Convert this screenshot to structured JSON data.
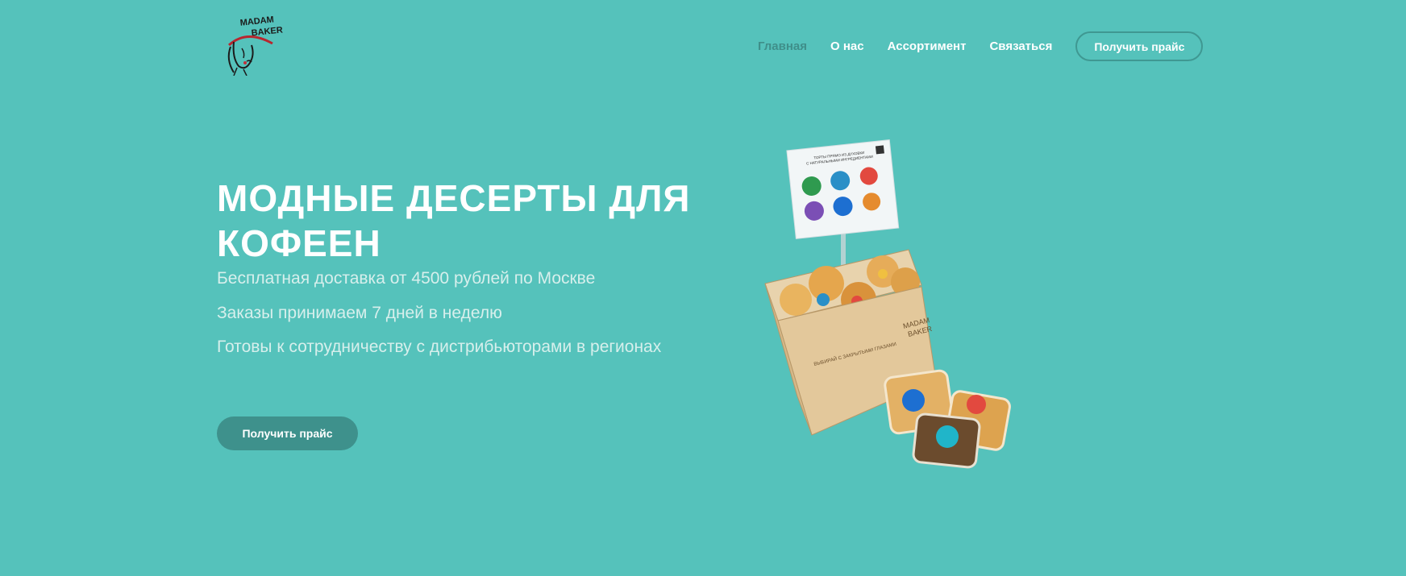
{
  "header": {
    "logo_text": [
      "MADAM",
      "BAKER"
    ],
    "nav": [
      {
        "label": "Главная",
        "active": true
      },
      {
        "label": "О нас",
        "active": false
      },
      {
        "label": "Ассортимент",
        "active": false
      },
      {
        "label": "Связаться",
        "active": false
      }
    ],
    "cta_label": "Получить прайс"
  },
  "hero": {
    "title": "МОДНЫЕ ДЕСЕРТЫ ДЛЯ КОФЕЕН",
    "lines": [
      "Бесплатная доставка от 4500 рублей по Москве",
      "Заказы принимаем 7 дней в неделю",
      "Готовы к сотрудничеству с дистрибьюторами в регионах"
    ],
    "cta_label": "Получить прайс"
  },
  "product_image": {
    "sign_lines": [
      "ТОРТЫ ПРЯМО ИЗ ДУХОВКИ",
      "С НАТУРАЛЬНЫМИ ИНГРЕДИЕНТАМИ"
    ],
    "box_text": "ВЫБИРАЙ С ЗАКРЫТЫМИ ГЛАЗАМИ",
    "box_brand": [
      "MADAM",
      "BAKER"
    ]
  },
  "colors": {
    "background": "#55c2bb",
    "accent_dark": "#3e918c",
    "text_light": "#d7efec",
    "active_nav": "#3f8f8a"
  }
}
